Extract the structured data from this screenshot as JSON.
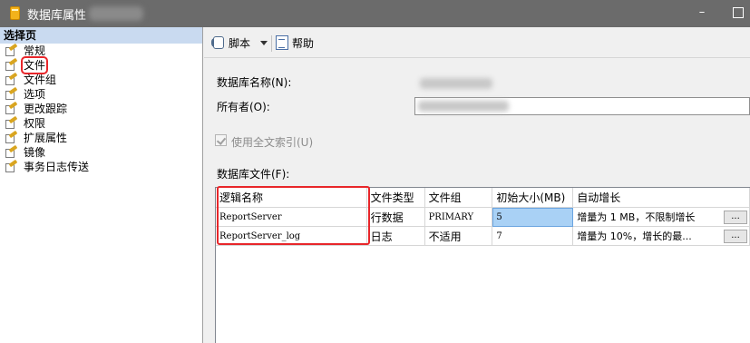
{
  "window": {
    "title": "数据库属性",
    "app_icon": "database-icon",
    "controls": {
      "minimize": "–"
    }
  },
  "sidebar": {
    "header": "选择页",
    "items": [
      {
        "label": "常规",
        "icon": "wrench-icon"
      },
      {
        "label": "文件",
        "icon": "wrench-icon",
        "selected": true
      },
      {
        "label": "文件组",
        "icon": "wrench-icon"
      },
      {
        "label": "选项",
        "icon": "wrench-icon"
      },
      {
        "label": "更改跟踪",
        "icon": "wrench-icon"
      },
      {
        "label": "权限",
        "icon": "wrench-icon"
      },
      {
        "label": "扩展属性",
        "icon": "wrench-icon"
      },
      {
        "label": "镜像",
        "icon": "wrench-icon"
      },
      {
        "label": "事务日志传送",
        "icon": "wrench-icon"
      }
    ]
  },
  "toolbar": {
    "script_label": "脚本",
    "help_label": "帮助"
  },
  "form": {
    "db_name_label": "数据库名称(N):",
    "owner_label": "所有者(O):",
    "fulltext_label": "使用全文索引(U)",
    "fulltext_checked": true,
    "files_label": "数据库文件(F):"
  },
  "grid": {
    "columns": [
      "逻辑名称",
      "文件类型",
      "文件组",
      "初始大小(MB)",
      "自动增长"
    ],
    "rows": [
      {
        "logical_name": "ReportServer",
        "type": "行数据",
        "filegroup": "PRIMARY",
        "size": "5",
        "growth": "增量为 1 MB，不限制增长",
        "button": "..."
      },
      {
        "logical_name": "ReportServer_log",
        "type": "日志",
        "filegroup": "不适用",
        "size": "7",
        "growth": "增量为 10%，增长的最...",
        "button": "..."
      }
    ]
  },
  "colors": {
    "titlebar": "#6b6b6b",
    "sidebar_header": "#c9daf0",
    "highlight": "#e8262a",
    "selected_cell": "#a9d1f5"
  }
}
